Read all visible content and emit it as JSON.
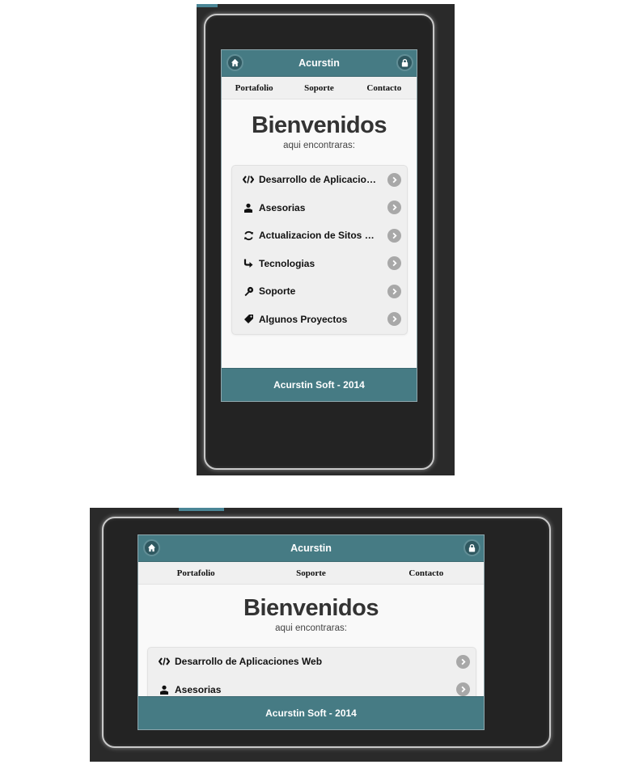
{
  "app": {
    "header_title": "Acurstin",
    "nav": [
      "Portafolio",
      "Soporte",
      "Contacto"
    ],
    "welcome_title": "Bienvenidos",
    "welcome_subtitle": "aqui encontraras:",
    "menu": [
      {
        "label": "Desarrollo de Aplicaciones Web",
        "icon": "code-icon"
      },
      {
        "label": "Asesorias",
        "icon": "user-icon"
      },
      {
        "label": "Actualizacion de Sitos Web",
        "icon": "refresh-icon"
      },
      {
        "label": "Tecnologias",
        "icon": "forward-icon"
      },
      {
        "label": "Soporte",
        "icon": "gear-icon"
      },
      {
        "label": "Algunos Proyectos",
        "icon": "tag-icon"
      }
    ],
    "footer": "Acurstin Soft - 2014"
  },
  "colors": {
    "bar": "#467b84",
    "device": "#232323",
    "arrow": "#a8a8a8"
  },
  "views": [
    "portrait",
    "landscape"
  ]
}
